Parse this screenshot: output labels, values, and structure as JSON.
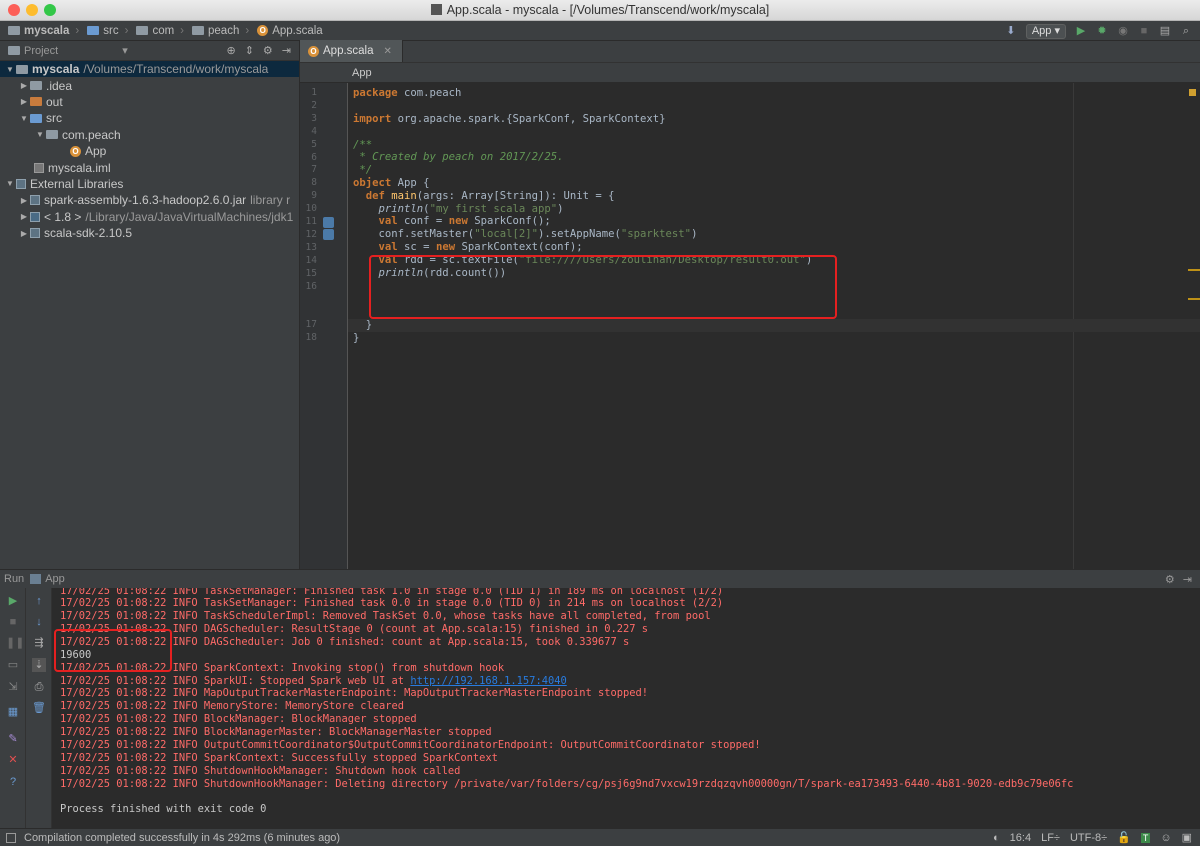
{
  "window": {
    "title": "App.scala - myscala - [/Volumes/Transcend/work/myscala]"
  },
  "navbar": {
    "crumbs": [
      "myscala",
      "src",
      "com",
      "peach",
      "App.scala"
    ],
    "run_config": "App"
  },
  "project": {
    "header": "Project",
    "tree": [
      {
        "label": "myscala",
        "path": "/Volumes/Transcend/work/myscala"
      },
      {
        "label": ".idea"
      },
      {
        "label": "out"
      },
      {
        "label": "src"
      },
      {
        "label": "com.peach"
      },
      {
        "label": "App"
      },
      {
        "label": "myscala.iml"
      },
      {
        "label": "External Libraries"
      },
      {
        "label": "spark-assembly-1.6.3-hadoop2.6.0.jar",
        "path": "library r"
      },
      {
        "label": "< 1.8 >",
        "path": "/Library/Java/JavaVirtualMachines/jdk1"
      },
      {
        "label": "scala-sdk-2.10.5"
      }
    ]
  },
  "editor": {
    "tab": "App.scala",
    "breadcrumb": "App",
    "line_numbers": [
      "1",
      "2",
      "3",
      "4",
      "5",
      "6",
      "7",
      "8",
      "9",
      "10",
      "11",
      "12",
      "13",
      "14",
      "15",
      "16",
      "17",
      "18"
    ],
    "code": {
      "l1a": "package",
      "l1b": " com.peach",
      "l3a": "import",
      "l3b": " org.apache.spark.{SparkConf, SparkContext}",
      "l5": "/**",
      "l6": " * Created by peach on 2017/2/25.",
      "l7": " */",
      "l8a": "object",
      "l8b": " App {",
      "l9a": "  def",
      "l9b": " main",
      "l9c": "(args: Array[String]): Unit = {",
      "l10a": "    println",
      "l10b": "(",
      "l10c": "\"my first scala app\"",
      "l10d": ")",
      "l11a": "    val",
      "l11b": " conf = ",
      "l11c": "new",
      "l11d": " SparkConf();",
      "l12a": "    conf.setMaster(",
      "l12b": "\"local[2]\"",
      "l12c": ").setAppName(",
      "l12d": "\"sparktest\"",
      "l12e": ")",
      "l13a": "    val",
      "l13b": " sc = ",
      "l13c": "new",
      "l13d": " SparkContext(conf);",
      "l14a": "    val",
      "l14b": " rdd = sc.textFile(",
      "l14c": "\"file:////Users/zoulihan/Desktop/result0.out\"",
      "l14d": ")",
      "l15a": "    println",
      "l15b": "(rdd.count())",
      "l16": "  }",
      "l17": "}"
    }
  },
  "run": {
    "header_label": "Run",
    "config": "App",
    "lines": [
      "17/02/25 01:08:22 INFO TaskSetManager: Finished task 1.0 in stage 0.0 (TID 1) in 189 ms on localhost (1/2)",
      "17/02/25 01:08:22 INFO TaskSetManager: Finished task 0.0 in stage 0.0 (TID 0) in 214 ms on localhost (2/2)",
      "17/02/25 01:08:22 INFO TaskSchedulerImpl: Removed TaskSet 0.0, whose tasks have all completed, from pool",
      "17/02/25 01:08:22 INFO DAGScheduler: ResultStage 0 (count at App.scala:15) finished in 0.227 s",
      "17/02/25 01:08:22 INFO DAGScheduler: Job 0 finished: count at App.scala:15, took 0.339677 s",
      "19600",
      "17/02/25 01:08:22 INFO SparkContext: Invoking stop() from shutdown hook",
      "17/02/25 01:08:22 INFO SparkUI: Stopped Spark web UI at ",
      "17/02/25 01:08:22 INFO MapOutputTrackerMasterEndpoint: MapOutputTrackerMasterEndpoint stopped!",
      "17/02/25 01:08:22 INFO MemoryStore: MemoryStore cleared",
      "17/02/25 01:08:22 INFO BlockManager: BlockManager stopped",
      "17/02/25 01:08:22 INFO BlockManagerMaster: BlockManagerMaster stopped",
      "17/02/25 01:08:22 INFO OutputCommitCoordinator$OutputCommitCoordinatorEndpoint: OutputCommitCoordinator stopped!",
      "17/02/25 01:08:22 INFO SparkContext: Successfully stopped SparkContext",
      "17/02/25 01:08:22 INFO ShutdownHookManager: Shutdown hook called",
      "17/02/25 01:08:22 INFO ShutdownHookManager: Deleting directory /private/var/folders/cg/psj6g9nd7vxcw19rzdqzqvh00000gn/T/spark-ea173493-6440-4b81-9020-edb9c79e06fc",
      "Process finished with exit code 0"
    ],
    "sparkui_link": "http://192.168.1.157:4040"
  },
  "status": {
    "message": "Compilation completed successfully in 4s 292ms (6 minutes ago)",
    "position": "16:4",
    "line_sep": "LF÷",
    "encoding": "UTF-8÷"
  }
}
